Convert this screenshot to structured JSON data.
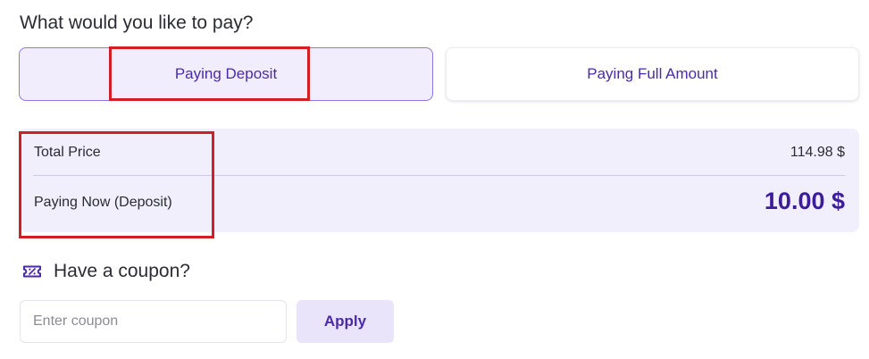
{
  "payment": {
    "question": "What would you like to pay?",
    "options": [
      {
        "label": "Paying Deposit",
        "selected": true
      },
      {
        "label": "Paying Full Amount",
        "selected": false
      }
    ]
  },
  "summary": {
    "total_price_label": "Total Price",
    "total_price_value": "114.98 $",
    "paying_now_label": "Paying Now (Deposit)",
    "paying_now_value": "10.00 $"
  },
  "coupon": {
    "icon": "coupon-ticket-icon",
    "title": "Have a coupon?",
    "placeholder": "Enter coupon",
    "value": "",
    "apply_label": "Apply"
  },
  "colors": {
    "accent": "#4b2aa8",
    "accent_dark": "#3d1c99",
    "selected_bg": "#f1edfd",
    "summary_bg": "#f1effb",
    "highlight_red": "#d21f26"
  }
}
